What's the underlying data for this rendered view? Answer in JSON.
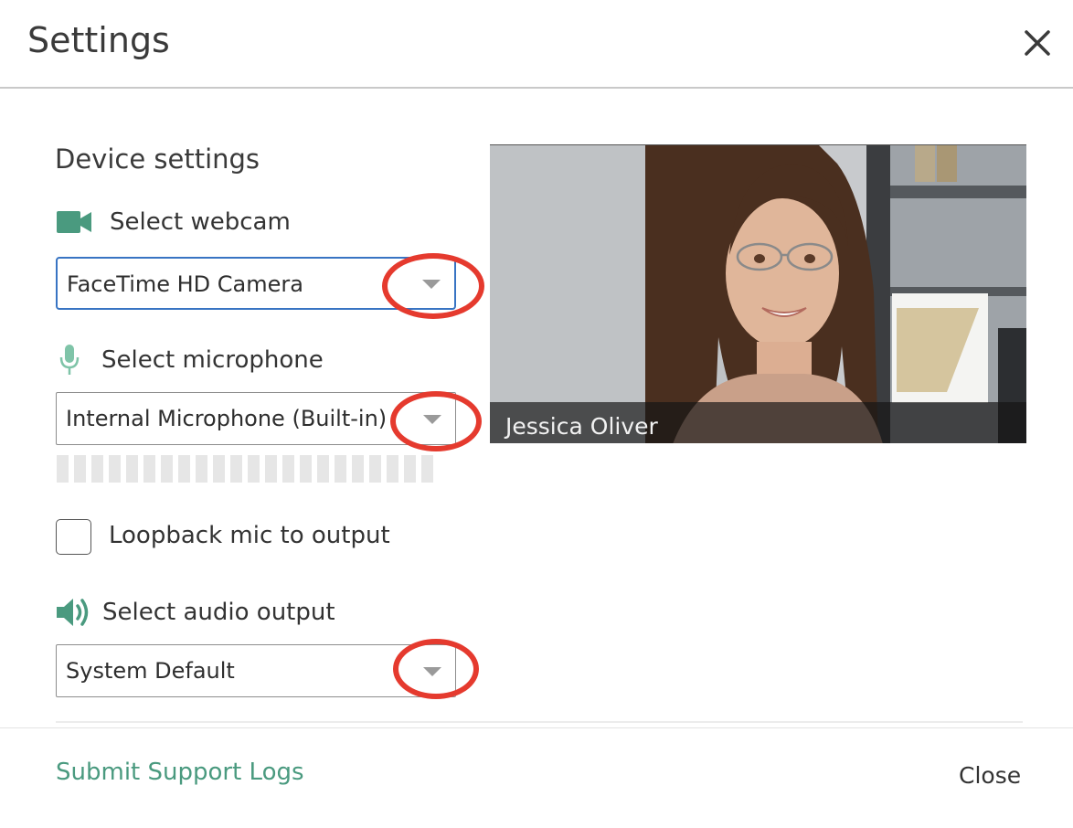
{
  "dialog": {
    "title": "Settings",
    "close_icon": "close-icon"
  },
  "device_settings": {
    "heading": "Device settings",
    "webcam": {
      "label": "Select webcam",
      "icon": "video-camera-icon",
      "selected": "FaceTime HD Camera"
    },
    "microphone": {
      "label": "Select microphone",
      "icon": "microphone-icon",
      "selected": "Internal Microphone (Built-in)",
      "level": 0
    },
    "loopback": {
      "label": "Loopback mic to output",
      "checked": false
    },
    "audio_output": {
      "label": "Select audio output",
      "icon": "speaker-icon",
      "selected": "System Default"
    }
  },
  "preview": {
    "name": "Jessica Oliver"
  },
  "footer": {
    "support_link": "Submit Support Logs",
    "close_label": "Close"
  },
  "colors": {
    "accent_green": "#4a9a7f",
    "focus_blue": "#3874c3",
    "highlight_red": "#e53a2e"
  }
}
